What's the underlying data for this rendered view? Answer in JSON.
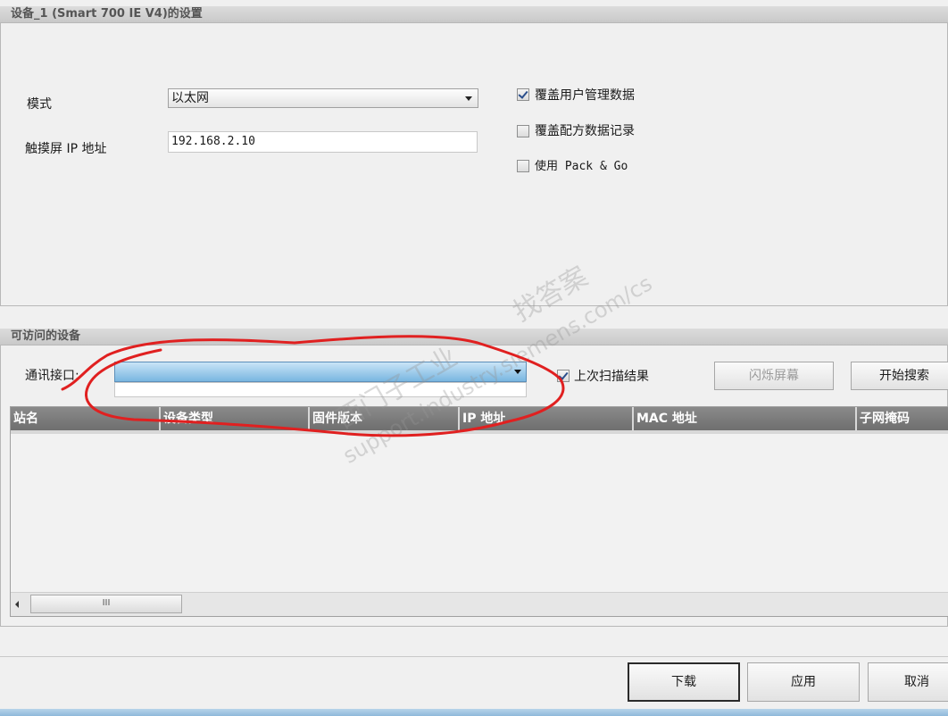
{
  "settings": {
    "title": "设备_1 (Smart 700 IE V4)的设置",
    "mode_label": "模式",
    "mode_value": "以太网",
    "ip_label": "触摸屏 IP 地址",
    "ip_value": "192.168.2.10",
    "options": [
      {
        "label": "覆盖用户管理数据",
        "checked": true
      },
      {
        "label": "覆盖配方数据记录",
        "checked": false
      },
      {
        "label": "使用 Pack & Go",
        "checked": false
      }
    ]
  },
  "devices": {
    "title": "可访问的设备",
    "interface_label": "通讯接口:",
    "interface_value": "",
    "last_scan_label": "上次扫描结果",
    "last_scan_checked": true,
    "flash_button": "闪烁屏幕",
    "search_button": "开始搜索",
    "columns": [
      "站名",
      "设备类型",
      "固件版本",
      "IP 地址",
      "MAC 地址",
      "子网掩码"
    ],
    "rows": [],
    "scroll_grip": "III"
  },
  "footer": {
    "download": "下载",
    "apply": "应用",
    "cancel": "取消"
  },
  "watermark": {
    "line1": "找答案",
    "line2": "西门子工业",
    "line3": "support.industry.siemens.com/cs"
  },
  "colors": {
    "annotation_red": "#e02020",
    "dropdown_blue": "#79b6e0"
  }
}
